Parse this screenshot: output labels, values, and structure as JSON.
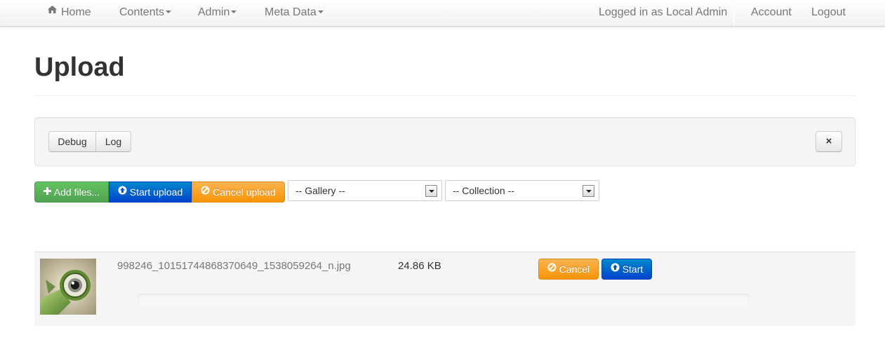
{
  "navbar": {
    "home_label": "Home",
    "contents_label": "Contents",
    "admin_label": "Admin",
    "meta_label": "Meta Data",
    "logged_in_text": "Logged in as Local Admin",
    "account_label": "Account",
    "logout_label": "Logout"
  },
  "page": {
    "title": "Upload"
  },
  "well": {
    "debug_label": "Debug",
    "log_label": "Log",
    "close_label": "×"
  },
  "toolbar": {
    "add_files_label": "Add files...",
    "start_upload_label": "Start upload",
    "cancel_upload_label": "Cancel upload",
    "gallery_select": "-- Gallery --",
    "collection_select": "-- Collection --"
  },
  "files": [
    {
      "name": "998246_10151744868370649_1538059264_n.jpg",
      "size": "24.86 KB",
      "cancel_label": "Cancel",
      "start_label": "Start",
      "progress": 0
    }
  ],
  "colors": {
    "success": "#51a351",
    "primary": "#0044cc",
    "warning": "#f89406"
  },
  "icons": {
    "home": "home-icon",
    "add": "plus-icon",
    "start": "arrow-circle-up-icon",
    "cancel": "ban-icon",
    "close": "close-icon"
  }
}
